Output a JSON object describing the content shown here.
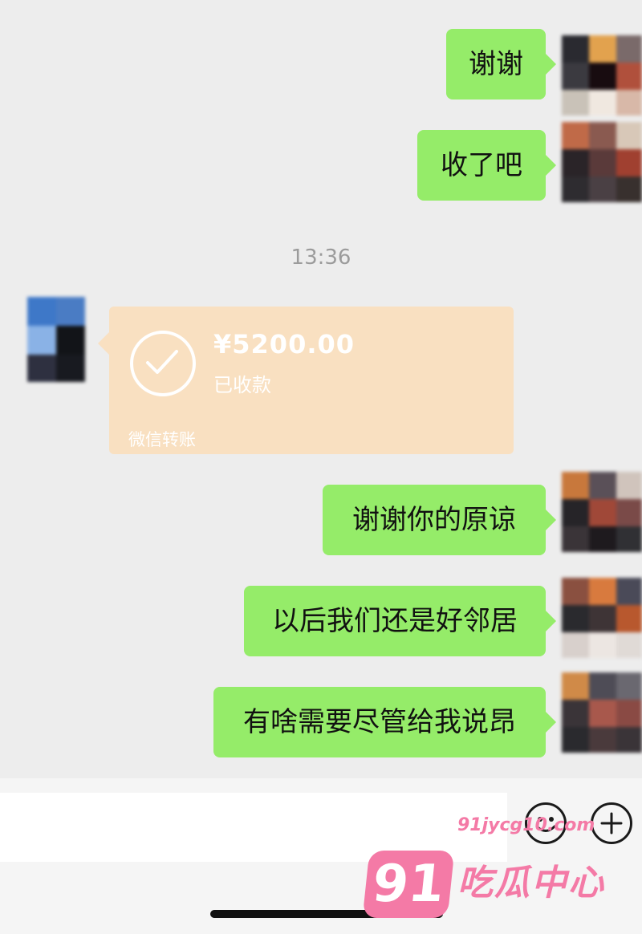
{
  "messages_out": [
    {
      "text": "谢谢"
    },
    {
      "text": "收了吧"
    },
    {
      "text": "谢谢你的原谅"
    },
    {
      "text": "以后我们还是好邻居"
    },
    {
      "text": "有啥需要尽管给我说昂"
    }
  ],
  "timestamp": "13:36",
  "transfer": {
    "amount": "¥5200.00",
    "status": "已收款",
    "label": "微信转账"
  },
  "input_bar": {
    "emoji_icon": "emoji-face-icon",
    "plus_icon": "plus-circle-icon"
  },
  "watermark": {
    "logo": "91",
    "site": "91jycg10.com",
    "name": "吃瓜中心"
  },
  "colors": {
    "bubble_out": "#95ec69",
    "transfer_card": "#f9e0c1",
    "background": "#ededed",
    "watermark": "#f47aa6"
  }
}
